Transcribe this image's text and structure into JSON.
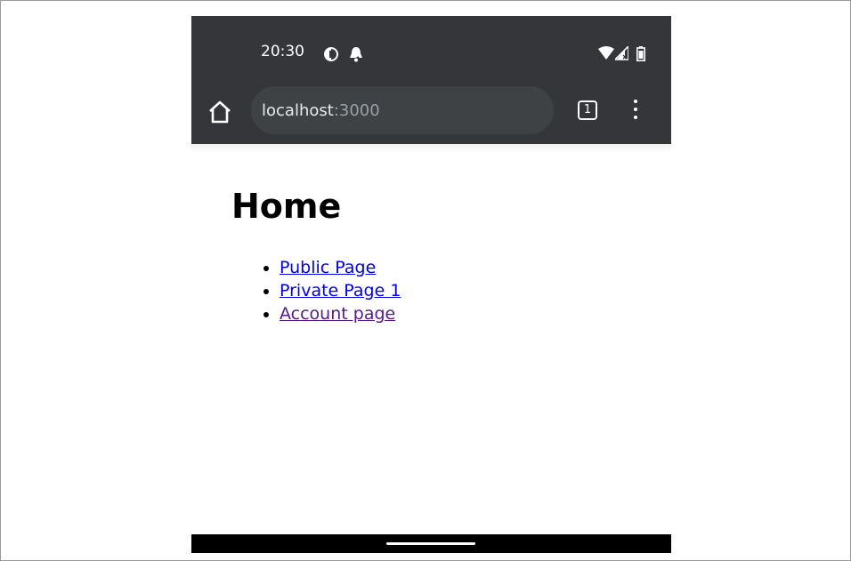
{
  "status_bar": {
    "time": "20:30",
    "icons": [
      "data-saver-icon",
      "notification-icon",
      "wifi-icon",
      "signal-icon",
      "battery-icon"
    ]
  },
  "toolbar": {
    "url_host": "localhost",
    "url_port": ":3000",
    "tab_count": "1",
    "icons": [
      "home-icon",
      "tab-switcher-icon",
      "more-vert-icon"
    ]
  },
  "page": {
    "heading": "Home",
    "links": [
      {
        "label": "Public Page",
        "visited": false
      },
      {
        "label": "Private Page 1",
        "visited": false
      },
      {
        "label": "Account page",
        "visited": true
      }
    ]
  },
  "colors": {
    "chrome_bg": "#343639",
    "omnibox_bg": "#3f4244",
    "link_unvisited": "#0000ee",
    "link_visited": "#551a8b"
  }
}
